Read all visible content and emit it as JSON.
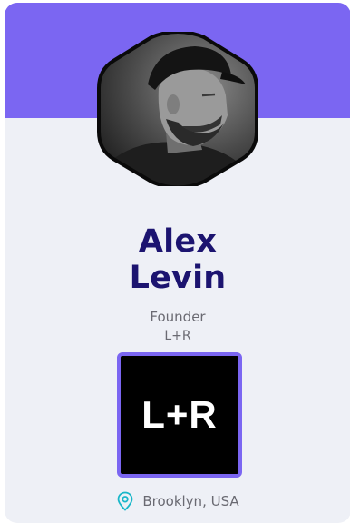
{
  "profile": {
    "first_name": "Alex",
    "last_name": "Levin",
    "role": "Founder",
    "company": "L+R",
    "logo_text": "L+R",
    "location": "Brooklyn, USA"
  },
  "colors": {
    "accent": "#7b66f2",
    "name": "#1c1470",
    "card_bg": "#eef0f6",
    "muted_text": "#6a6a72",
    "pin": "#19b7c9"
  },
  "icons": {
    "location": "map-pin-icon"
  }
}
